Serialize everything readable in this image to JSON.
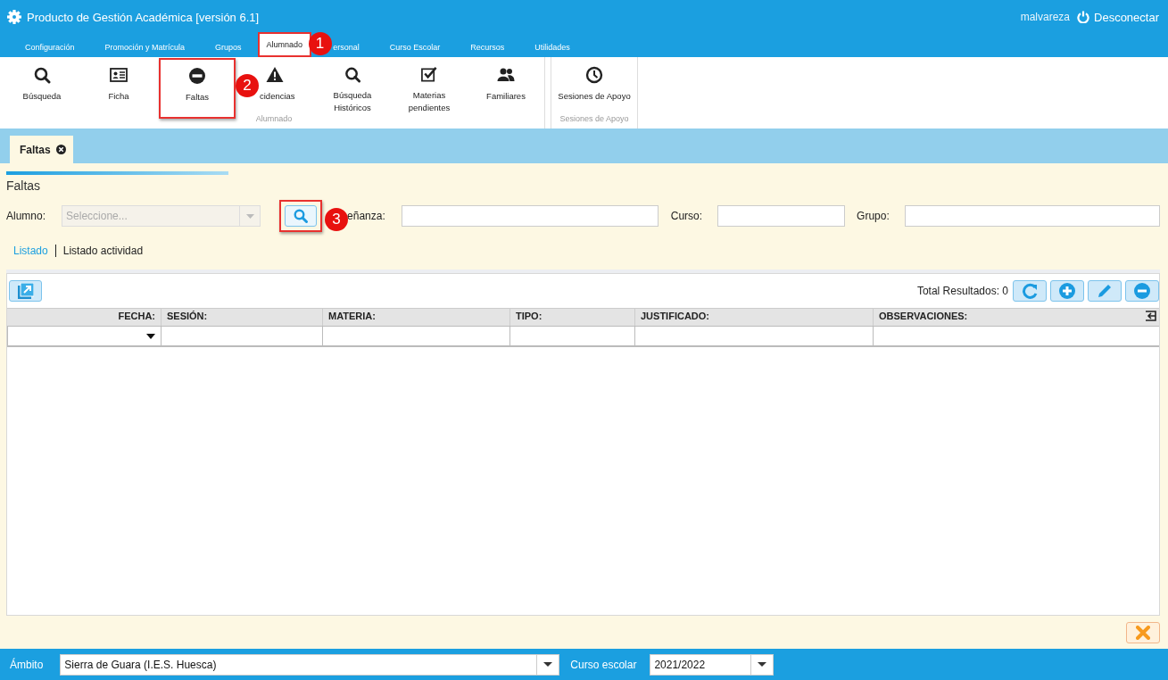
{
  "window": {
    "title": "Producto de Gestión Académica [versión 6.1]",
    "user": "malvareza",
    "logout": "Desconectar"
  },
  "menu_tabs": [
    {
      "label": "Configuración",
      "selected": false
    },
    {
      "label": "Promoción y Matrícula",
      "selected": false
    },
    {
      "label": "Grupos",
      "selected": false
    },
    {
      "label": "Alumnado",
      "selected": true,
      "callout": "1"
    },
    {
      "label": "ersonal",
      "selected": false
    },
    {
      "label": "Curso Escolar",
      "selected": false
    },
    {
      "label": "Recursos",
      "selected": false
    },
    {
      "label": "Utilidades",
      "selected": false
    }
  ],
  "ribbon": [
    {
      "label": "Alumnado",
      "items": [
        {
          "label": "Búsqueda"
        },
        {
          "label": "Ficha"
        },
        {
          "label": "Faltas",
          "callout": "2"
        },
        {
          "label": "cidencias"
        },
        {
          "label": "Búsqueda Históricos"
        },
        {
          "label": "Materias pendientes"
        },
        {
          "label": "Familiares"
        }
      ]
    },
    {
      "label": "Sesiones de Apoyo",
      "items": [
        {
          "label": "Sesiones de Apoyo"
        }
      ]
    }
  ],
  "doc_tabs": [
    {
      "label": "Faltas",
      "selected": true
    }
  ],
  "page": {
    "title": "Faltas",
    "fields": [
      {
        "kind": "select",
        "label": "Alumno:",
        "placeholder": "Seleccione...",
        "disabled": true
      },
      {
        "kind": "search-button",
        "callout": "3"
      },
      {
        "kind": "text",
        "label": "eñanza:"
      },
      {
        "kind": "text",
        "label": "Curso:"
      },
      {
        "kind": "text",
        "label": "Grupo:"
      }
    ],
    "subtabs": [
      {
        "label": "Listado",
        "selected": true
      },
      {
        "label": "Listado actividad",
        "selected": false
      }
    ]
  },
  "grid": {
    "total": "Total Resultados: 0",
    "columns": [
      {
        "label": "FECHA:",
        "kind": "dropdown"
      },
      {
        "label": "SESIÓN:",
        "kind": "text"
      },
      {
        "label": "MATERIA:",
        "kind": "text"
      },
      {
        "label": "TIPO:",
        "kind": "text"
      },
      {
        "label": "JUSTIFICADO:",
        "kind": "text"
      },
      {
        "label": "OBSERVACIONES:",
        "kind": "text"
      }
    ]
  },
  "footer": {
    "scope_label": "Ámbito",
    "scope": "Sierra de Guara (I.E.S. Huesca)",
    "year_label": "Curso escolar",
    "year": "2021/2022"
  }
}
